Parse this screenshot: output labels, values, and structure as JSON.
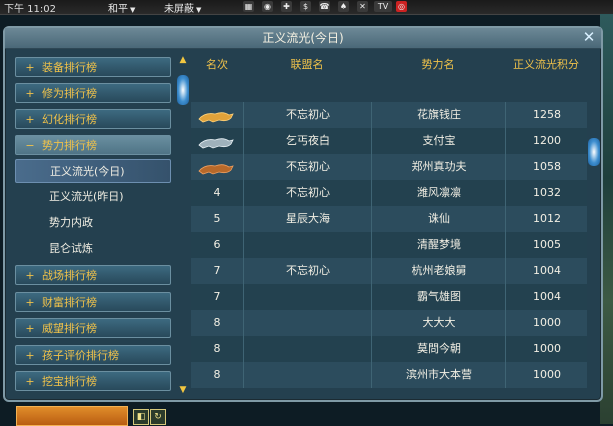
{
  "hud": {
    "clock": "下午 11:02",
    "channel": "和平",
    "shield": "未屏蔽",
    "tv_label": "TV",
    "icons": [
      "map-icon",
      "camera-icon",
      "gift-icon",
      "dollar-icon",
      "chat-icon",
      "spade-icon",
      "cross-swords-icon",
      "tv-icon",
      "target-icon"
    ]
  },
  "window": {
    "title": "正义流光(今日)",
    "close_icon": "close-icon"
  },
  "nav": {
    "items": [
      {
        "sign": "+",
        "label": "装备排行榜"
      },
      {
        "sign": "+",
        "label": "修为排行榜"
      },
      {
        "sign": "+",
        "label": "幻化排行榜"
      },
      {
        "sign": "−",
        "label": "势力排行榜"
      },
      {
        "sign": "+",
        "label": "战场排行榜"
      },
      {
        "sign": "+",
        "label": "财富排行榜"
      },
      {
        "sign": "+",
        "label": "威望排行榜"
      },
      {
        "sign": "+",
        "label": "孩子评价排行榜"
      },
      {
        "sign": "+",
        "label": "挖宝排行榜"
      }
    ],
    "sub_items": [
      "正义流光(今日)",
      "正义流光(昨日)",
      "势力内政",
      "昆仑试炼"
    ],
    "active_sub": 0
  },
  "table": {
    "headers": [
      "名次",
      "联盟名",
      "势力名",
      "正义流光积分"
    ],
    "rows": [
      {
        "rank": "",
        "rank_icon": "gold-panther-icon",
        "alliance": "不忘初心",
        "faction": "花旗钱庄",
        "score": "1258"
      },
      {
        "rank": "",
        "rank_icon": "silver-panther-icon",
        "alliance": "乞丐夜白",
        "faction": "支付宝",
        "score": "1200"
      },
      {
        "rank": "",
        "rank_icon": "bronze-panther-icon",
        "alliance": "不忘初心",
        "faction": "郑州真功夫",
        "score": "1058"
      },
      {
        "rank": "4",
        "rank_icon": "",
        "alliance": "不忘初心",
        "faction": "潍风凛凛",
        "score": "1032"
      },
      {
        "rank": "5",
        "rank_icon": "",
        "alliance": "星辰大海",
        "faction": "诛仙",
        "score": "1012"
      },
      {
        "rank": "6",
        "rank_icon": "",
        "alliance": "",
        "faction": "清醒梦境",
        "score": "1005"
      },
      {
        "rank": "7",
        "rank_icon": "",
        "alliance": "不忘初心",
        "faction": "杭州老娘舅",
        "score": "1004"
      },
      {
        "rank": "7",
        "rank_icon": "",
        "alliance": "",
        "faction": "霸气雄图",
        "score": "1004"
      },
      {
        "rank": "8",
        "rank_icon": "",
        "alliance": "",
        "faction": "大大大",
        "score": "1000"
      },
      {
        "rank": "8",
        "rank_icon": "",
        "alliance": "",
        "faction": "莫問今朝",
        "score": "1000"
      },
      {
        "rank": "8",
        "rank_icon": "",
        "alliance": "",
        "faction": "滨州市大本营",
        "score": "1000"
      }
    ]
  },
  "colors": {
    "gold": "#f0c24a",
    "panel": "#24404f",
    "row_odd": "#2c4c5d",
    "row_even": "#23414f"
  }
}
